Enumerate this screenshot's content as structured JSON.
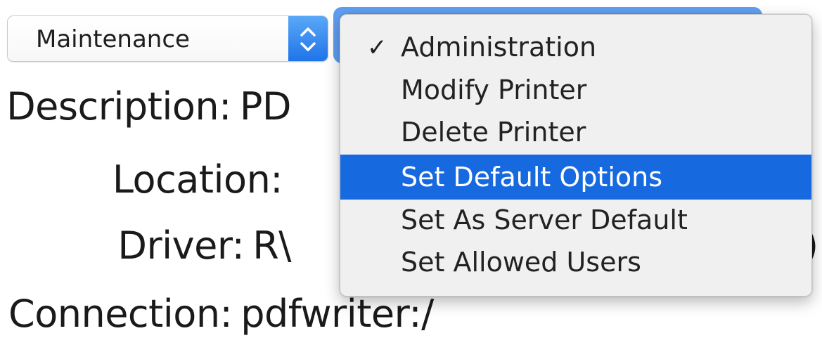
{
  "select": {
    "value": "Maintenance",
    "stepper_icon": "up-down-chevron-icon"
  },
  "info": {
    "description_label": "Description:",
    "description_value": "PD",
    "location_label": "Location:",
    "location_value": "",
    "driver_label": "Driver:",
    "driver_value": "R\\",
    "driver_trailing": ")",
    "connection_label": "Connection:",
    "connection_value": "pdfwriter:/"
  },
  "menu": {
    "items": [
      {
        "label": "Administration",
        "checked": true,
        "highlighted": false
      },
      {
        "label": "Modify Printer",
        "checked": false,
        "highlighted": false
      },
      {
        "label": "Delete Printer",
        "checked": false,
        "highlighted": false
      },
      {
        "label": "Set Default Options",
        "checked": false,
        "highlighted": true
      },
      {
        "label": "Set As Server Default",
        "checked": false,
        "highlighted": false
      },
      {
        "label": "Set Allowed Users",
        "checked": false,
        "highlighted": false
      }
    ],
    "check_glyph": "✓"
  },
  "colors": {
    "accent": "#1769e0",
    "stepper": "#2f86ee",
    "menu_background": "#f0f0f0"
  }
}
